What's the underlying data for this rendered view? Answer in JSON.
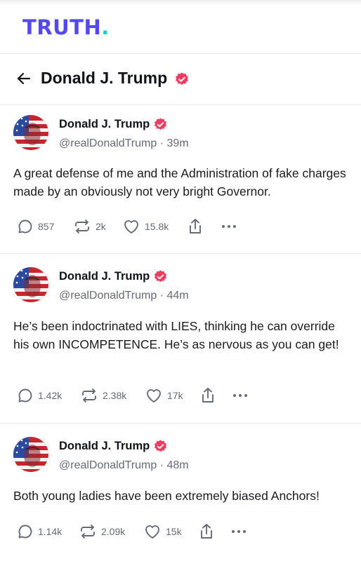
{
  "brand": {
    "logo_main": "TRUTH",
    "logo_dot": ".",
    "primary_color": "#5448ee",
    "accent_color": "#17d2c0"
  },
  "header": {
    "title": "Donald J. Trump",
    "back_icon": "arrow-left-icon",
    "verified_color": "#ef3c61"
  },
  "posts": [
    {
      "author": "Donald J. Trump",
      "handle_time": "@realDonaldTrump · 39m",
      "text": "A great defense of me and the Administration of fake charges made by an obviously not very bright Governor.",
      "replies": "857",
      "retruths": "2k",
      "likes": "15.8k"
    },
    {
      "author": "Donald J. Trump",
      "handle_time": "@realDonaldTrump · 44m",
      "text": "He’s been indoctrinated with LIES, thinking he can override his own INCOMPETENCE. He’s as nervous as you can get!",
      "replies": "1.42k",
      "retruths": "2.38k",
      "likes": "17k"
    },
    {
      "author": "Donald J. Trump",
      "handle_time": "@realDonaldTrump · 48m",
      "text": "Both young ladies have been extremely biased Anchors!",
      "replies": "1.14k",
      "retruths": "2.09k",
      "likes": "15k"
    }
  ]
}
